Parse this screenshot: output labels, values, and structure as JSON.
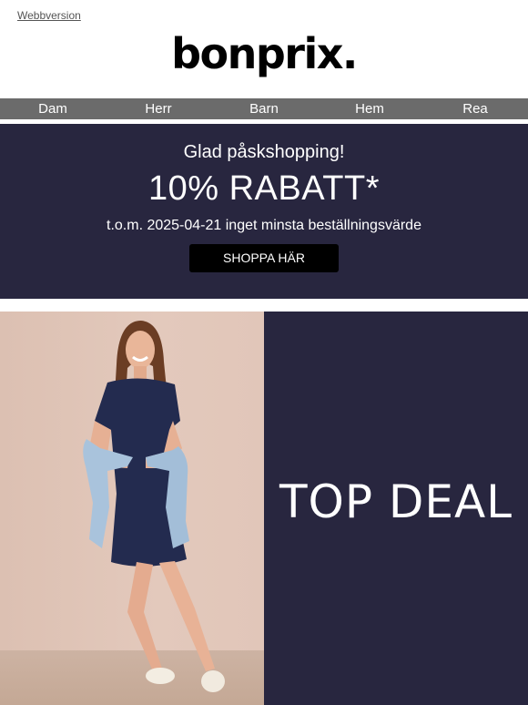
{
  "header": {
    "webversion_label": "Webbversion",
    "logo_text": "bonprix."
  },
  "nav": {
    "items": [
      {
        "label": "Dam"
      },
      {
        "label": "Herr"
      },
      {
        "label": "Barn"
      },
      {
        "label": "Hem"
      },
      {
        "label": "Rea"
      }
    ]
  },
  "promo": {
    "greeting": "Glad påskshopping!",
    "headline": "10% RABATT*",
    "subline": "t.o.m. 2025-04-21 inget minsta beställningsvärde",
    "button_label": "SHOPPA HÄR",
    "background_color": "#28263f"
  },
  "hero": {
    "title": "TOP DEAL",
    "panel_color": "#28263f"
  }
}
